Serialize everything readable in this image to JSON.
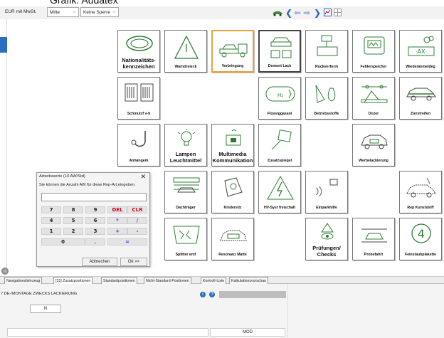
{
  "caption": "Grafik: Audatex",
  "toolbar": {
    "price_mode": "EUR mit MwSt.",
    "position": "Mitte",
    "lock": "Keine Sperre"
  },
  "tiles": [
    {
      "label": "Nationalitäts-\nkennzeichen",
      "icon": "nationality-plate-icon",
      "big": true
    },
    {
      "label": "Warndreieck",
      "icon": "warning-triangle-icon"
    },
    {
      "label": "Verbringung",
      "icon": "tow-truck-icon",
      "selected": true
    },
    {
      "label": "Demont Lack",
      "icon": "dismount-paint-icon",
      "dark": true
    },
    {
      "label": "Ruckverform",
      "icon": "reshape-icon"
    },
    {
      "label": "Fehlerspeicher",
      "icon": "error-memory-icon"
    },
    {
      "label": "Wiederanmeldeg",
      "icon": "reregistration-icon"
    },
    {
      "label": "Schmutzf v-h",
      "icon": "mudflap-icon"
    },
    {
      "label": "Flüssiggasanl",
      "icon": "lpg-tank-icon"
    },
    {
      "label": "Betriebsstoffe",
      "icon": "fluids-icon"
    },
    {
      "label": "Dozer",
      "icon": "dozer-icon"
    },
    {
      "label": "Zierstreifen",
      "icon": "decor-stripe-icon"
    },
    {
      "label": "Anhängerk",
      "icon": "tow-hitch-icon"
    },
    {
      "label": "Lampen\nLeuchtmittel",
      "icon": "lamp-icon",
      "big": true
    },
    {
      "label": "Multimedia\nKommunikation",
      "icon": "multimedia-icon",
      "big": true
    },
    {
      "label": "Zusatzspiegel",
      "icon": "mirror-icon"
    },
    {
      "label": "Werbelackierung",
      "icon": "advert-paint-icon"
    },
    {
      "label": "Dachträger",
      "icon": "roof-rack-icon"
    },
    {
      "label": "Kindersitz",
      "icon": "child-seat-icon"
    },
    {
      "label": "HV-Syst freischalt",
      "icon": "high-voltage-icon"
    },
    {
      "label": "Einparkhilfe",
      "icon": "parking-aid-icon"
    },
    {
      "label": "Rep Kunststoff",
      "icon": "plastic-repair-icon"
    },
    {
      "label": "Splitter entf",
      "icon": "glass-splinter-icon"
    },
    {
      "label": "Resonanz Matte",
      "icon": "resonance-mat-icon"
    },
    {
      "label": "Prüfungen/\nChecks",
      "icon": "inspection-icon",
      "big": true
    },
    {
      "label": "Probefahrt",
      "icon": "test-drive-icon"
    },
    {
      "label": "Feinstaubplakette",
      "icon": "emission-sticker-icon"
    }
  ],
  "dialog": {
    "title": "Arbeitswerte (10 AW/Std)",
    "close": "✕",
    "prompt": "Sie können die Anzahl AW für diese Rep-Art eingeben.",
    "keys": [
      "7",
      "8",
      "9",
      "DEL",
      "CLR",
      "4",
      "5",
      "6",
      "*",
      "/",
      "1",
      "2",
      "3",
      "+",
      "-",
      "0",
      ",",
      "="
    ],
    "cancel": "Abbrechen",
    "ok": "Ok >>"
  },
  "tabs": [
    "Navigationsfahrzeug",
    "[31] Zusatzpositionen",
    "Standardpositionen",
    "Nicht-Standard-Positionen",
    "Kontroll-Liste",
    "Kalkulationsvorschau"
  ],
  "bottom": {
    "position_text": "7 DE-/MONTAGE ZWECKS LACKIERUNG",
    "field_value": "N",
    "mod": "MOD",
    "info_badge": "i",
    "help_badge": "?"
  },
  "colors": {
    "icon_green": "#2e7d32",
    "selected_border": "#e8a33d",
    "del_red": "#d0021b",
    "op_blue": "#2255cc",
    "arrow_blue": "#1e5fb4",
    "car_green": "#3b8e2f"
  }
}
